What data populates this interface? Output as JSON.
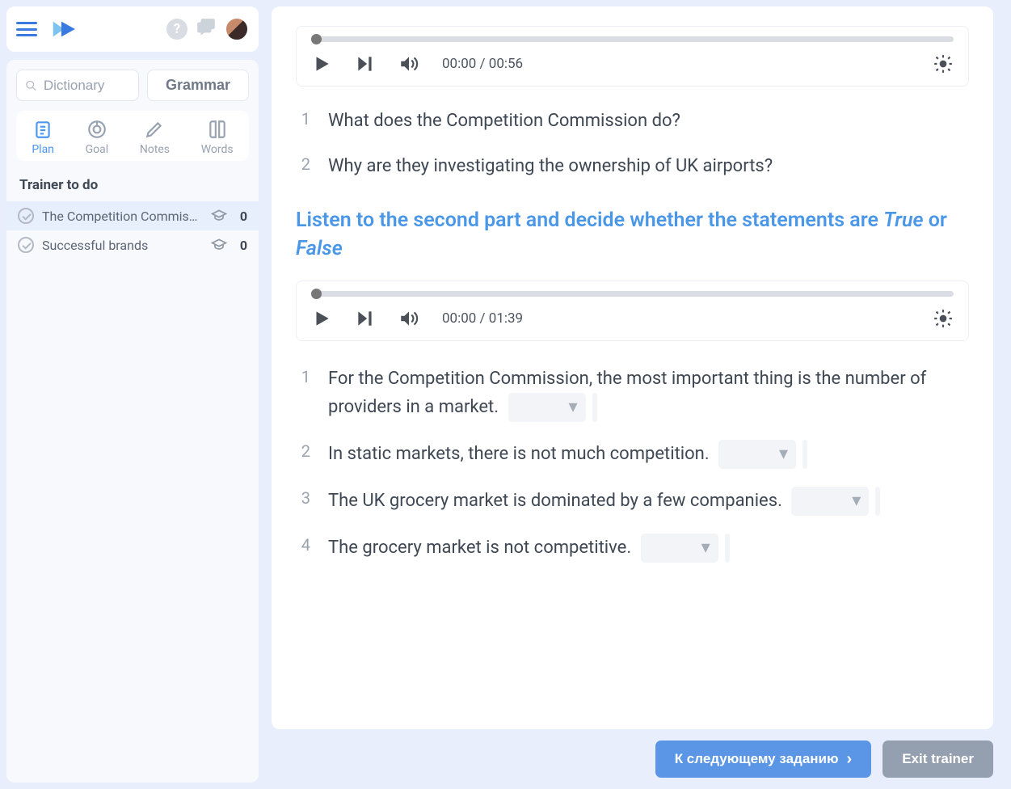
{
  "header": {
    "dictionary_placeholder": "Dictionary",
    "grammar_label": "Grammar"
  },
  "tools": {
    "plan": "Plan",
    "goal": "Goal",
    "notes": "Notes",
    "words": "Words"
  },
  "sidebar": {
    "section_title": "Trainer to do",
    "items": [
      {
        "label": "The Competition Commiss...",
        "count": "0"
      },
      {
        "label": "Successful brands",
        "count": "0"
      }
    ]
  },
  "audio1": {
    "time": "00:00 / 00:56"
  },
  "audio2": {
    "time": "00:00 / 01:39"
  },
  "questions": [
    {
      "num": "1",
      "text": "What does the Competition Commission do?"
    },
    {
      "num": "2",
      "text": "Why are they investigating the ownership of UK airports?"
    }
  ],
  "instruction": {
    "pre": "Listen to the second part and decide whether the statements are ",
    "em1": "True",
    "mid": " or ",
    "em2": "False"
  },
  "statements": [
    {
      "num": "1",
      "text": "For the Competition Commission, the most important thing is the number of providers in a market."
    },
    {
      "num": "2",
      "text": "In static markets, there is not much competition."
    },
    {
      "num": "3",
      "text": "The UK grocery market is dominated by a few companies."
    },
    {
      "num": "4",
      "text": "The grocery market is not competitive."
    }
  ],
  "footer": {
    "next": "К следующему заданию",
    "exit": "Exit trainer"
  }
}
